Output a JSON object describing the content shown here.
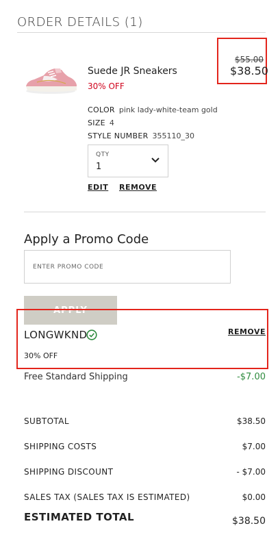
{
  "header": {
    "title": "ORDER DETAILS (1)"
  },
  "item": {
    "name": "Suede JR Sneakers",
    "discount_label": "30% OFF",
    "original_price": "$55.00",
    "price": "$38.50",
    "color_label": "COLOR",
    "color_value": "pink lady-white-team gold",
    "size_label": "SIZE",
    "size_value": "4",
    "style_label": "STYLE NUMBER",
    "style_value": "355110_30",
    "qty_label": "QTY",
    "qty_value": "1",
    "edit_label": "EDIT",
    "remove_label": "REMOVE"
  },
  "promo": {
    "heading": "Apply a Promo Code",
    "placeholder": "ENTER PROMO CODE",
    "apply_label": "APPLY",
    "applied_code": "LONGWKND",
    "applied_discount": "30% OFF",
    "remove_label": "REMOVE"
  },
  "shipping": {
    "label": "Free Standard Shipping",
    "value": "-$7.00"
  },
  "summary": {
    "rows": [
      {
        "label": "SUBTOTAL",
        "value": "$38.50"
      },
      {
        "label": "SHIPPING COSTS",
        "value": "$7.00"
      },
      {
        "label": "SHIPPING DISCOUNT",
        "value": "- $7.00"
      },
      {
        "label": "SALES TAX (SALES TAX IS ESTIMATED)",
        "value": "$0.00"
      }
    ],
    "total_label": "ESTIMATED TOTAL",
    "total_value": "$38.50"
  },
  "colors": {
    "sale_red": "#d0021b",
    "highlight_red": "#e3241b",
    "success_green": "#2e8b3e",
    "button_disabled": "#cfcdc5"
  },
  "icons": [
    "sneaker-image",
    "chevron-down-icon",
    "check-circle-icon"
  ]
}
